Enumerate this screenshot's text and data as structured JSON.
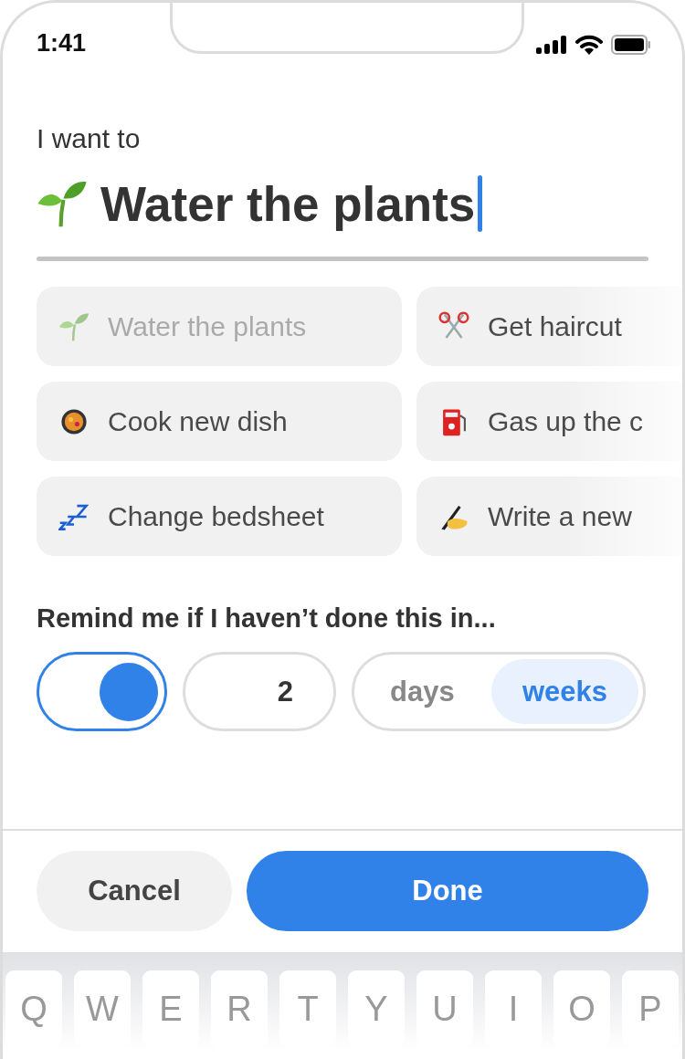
{
  "status_bar": {
    "time": "1:41"
  },
  "prompt": "I want to",
  "title": {
    "kind": "sprout",
    "value": "Water the plants",
    "focused": true
  },
  "suggestions": [
    {
      "kind": "sprout",
      "label": "Water the plants",
      "disabled": true
    },
    {
      "kind": "scissors",
      "label": "Get haircut",
      "disabled": false
    },
    {
      "kind": "pan",
      "label": "Cook new dish",
      "disabled": false
    },
    {
      "kind": "fuel",
      "label": "Gas up the c",
      "disabled": false
    },
    {
      "kind": "zzz",
      "label": "Change bedsheet",
      "disabled": false
    },
    {
      "kind": "writing",
      "label": "Write a new",
      "disabled": false
    }
  ],
  "remind": {
    "label": "Remind me if I haven’t done this in...",
    "on": true,
    "count": "2",
    "units": [
      {
        "label": "days",
        "selected": false
      },
      {
        "label": "weeks",
        "selected": true
      }
    ]
  },
  "buttons": {
    "cancel": "Cancel",
    "done": "Done"
  },
  "keyboard": [
    "Q",
    "W",
    "E",
    "R",
    "T",
    "Y",
    "U",
    "I",
    "O",
    "P"
  ]
}
